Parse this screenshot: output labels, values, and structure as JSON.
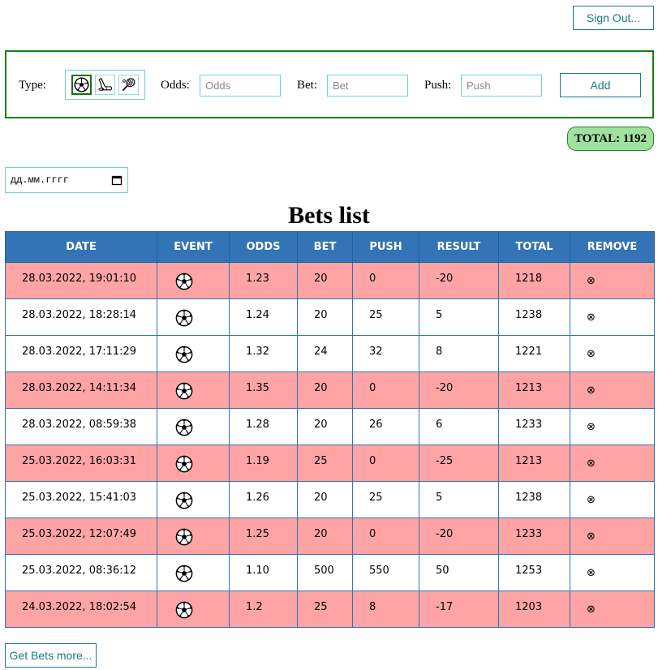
{
  "header": {
    "sign_out_label": "Sign Out..."
  },
  "form": {
    "type_label": "Type:",
    "type_options": [
      "soccer-ball-icon",
      "hockey-stick-icon",
      "tennis-racket-icon"
    ],
    "selected_type": "soccer-ball-icon",
    "odds_label": "Odds:",
    "odds_placeholder": "Odds",
    "bet_label": "Bet:",
    "bet_placeholder": "Bet",
    "push_label": "Push:",
    "push_placeholder": "Push",
    "add_label": "Add"
  },
  "total": {
    "text": "TOTAL: 1192"
  },
  "date_filter": {
    "placeholder": "дд.мм.гггг",
    "icon": "calendar-icon"
  },
  "list": {
    "title": "Bets list",
    "columns": [
      "DATE",
      "EVENT",
      "ODDS",
      "BET",
      "PUSH",
      "RESULT",
      "TOTAL",
      "REMOVE"
    ],
    "remove_glyph": "⊗",
    "rows": [
      {
        "date": "28.03.2022, 19:01:10",
        "event": "soccer-ball-icon",
        "odds": "1.23",
        "bet": "20",
        "push": "0",
        "result": "-20",
        "total": "1218",
        "loss": true
      },
      {
        "date": "28.03.2022, 18:28:14",
        "event": "soccer-ball-icon",
        "odds": "1.24",
        "bet": "20",
        "push": "25",
        "result": "5",
        "total": "1238",
        "loss": false
      },
      {
        "date": "28.03.2022, 17:11:29",
        "event": "soccer-ball-icon",
        "odds": "1.32",
        "bet": "24",
        "push": "32",
        "result": "8",
        "total": "1221",
        "loss": false
      },
      {
        "date": "28.03.2022, 14:11:34",
        "event": "soccer-ball-icon",
        "odds": "1.35",
        "bet": "20",
        "push": "0",
        "result": "-20",
        "total": "1213",
        "loss": true
      },
      {
        "date": "28.03.2022, 08:59:38",
        "event": "soccer-ball-icon",
        "odds": "1.28",
        "bet": "20",
        "push": "26",
        "result": "6",
        "total": "1233",
        "loss": false
      },
      {
        "date": "25.03.2022, 16:03:31",
        "event": "soccer-ball-icon",
        "odds": "1.19",
        "bet": "25",
        "push": "0",
        "result": "-25",
        "total": "1213",
        "loss": true
      },
      {
        "date": "25.03.2022, 15:41:03",
        "event": "soccer-ball-icon",
        "odds": "1.26",
        "bet": "20",
        "push": "25",
        "result": "5",
        "total": "1238",
        "loss": false
      },
      {
        "date": "25.03.2022, 12:07:49",
        "event": "soccer-ball-icon",
        "odds": "1.25",
        "bet": "20",
        "push": "0",
        "result": "-20",
        "total": "1233",
        "loss": true
      },
      {
        "date": "25.03.2022, 08:36:12",
        "event": "soccer-ball-icon",
        "odds": "1.10",
        "bet": "500",
        "push": "550",
        "result": "50",
        "total": "1253",
        "loss": false
      },
      {
        "date": "24.03.2022, 18:02:54",
        "event": "soccer-ball-icon",
        "odds": "1.2",
        "bet": "25",
        "push": "8",
        "result": "-17",
        "total": "1203",
        "loss": true
      }
    ]
  },
  "footer": {
    "more_label": "Get Bets more..."
  },
  "colors": {
    "header_bg": "#3274b5",
    "loss_row": "#ffa4a4",
    "total_badge": "#9fe29f",
    "accent": "#1a7a8a"
  }
}
